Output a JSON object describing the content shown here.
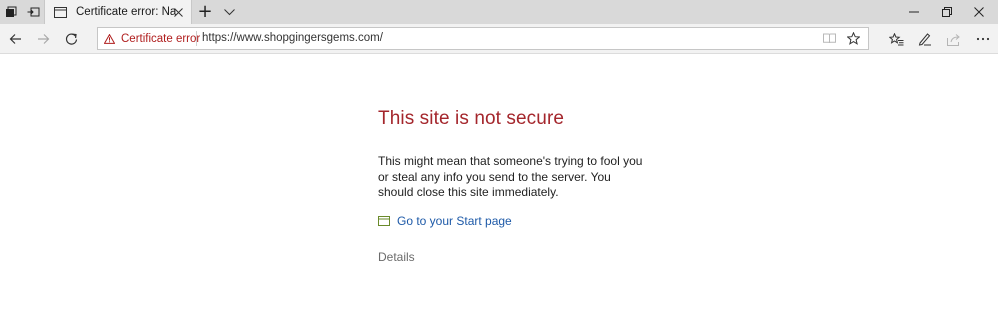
{
  "window": {
    "tab_title": "Certificate error: Naviga",
    "new_tab_symbol": "+",
    "icons": {
      "set_aside": "tabs-aside-icon",
      "show_aside": "show-set-aside-icon",
      "tab_favicon": "page-icon",
      "tab_close": "close-icon",
      "tab_preview": "chevron-down-icon",
      "minimize": "minimize-icon",
      "restore": "restore-icon",
      "close": "close-window-icon"
    }
  },
  "navbar": {
    "cert_error_label": "Certificate error",
    "url": "https://www.shopgingersgems.com/",
    "icons": {
      "back": "back-arrow-icon",
      "forward": "forward-arrow-icon",
      "refresh": "refresh-icon",
      "warning": "warning-icon",
      "reading_view": "reading-view-icon",
      "favorite": "star-icon",
      "favorites_hub": "favorites-hub-icon",
      "notes": "pen-icon",
      "share": "share-icon",
      "more": "more-icon"
    }
  },
  "page": {
    "title": "This site is not secure",
    "description": "This might mean that someone's trying to fool you or steal any info you send to the server. You should close this site immediately.",
    "start_link": "Go to your Start page",
    "details": "Details"
  },
  "colors": {
    "title_red": "#a4262c",
    "link_blue": "#1e5aa8",
    "warning_red": "#b01e1e"
  }
}
